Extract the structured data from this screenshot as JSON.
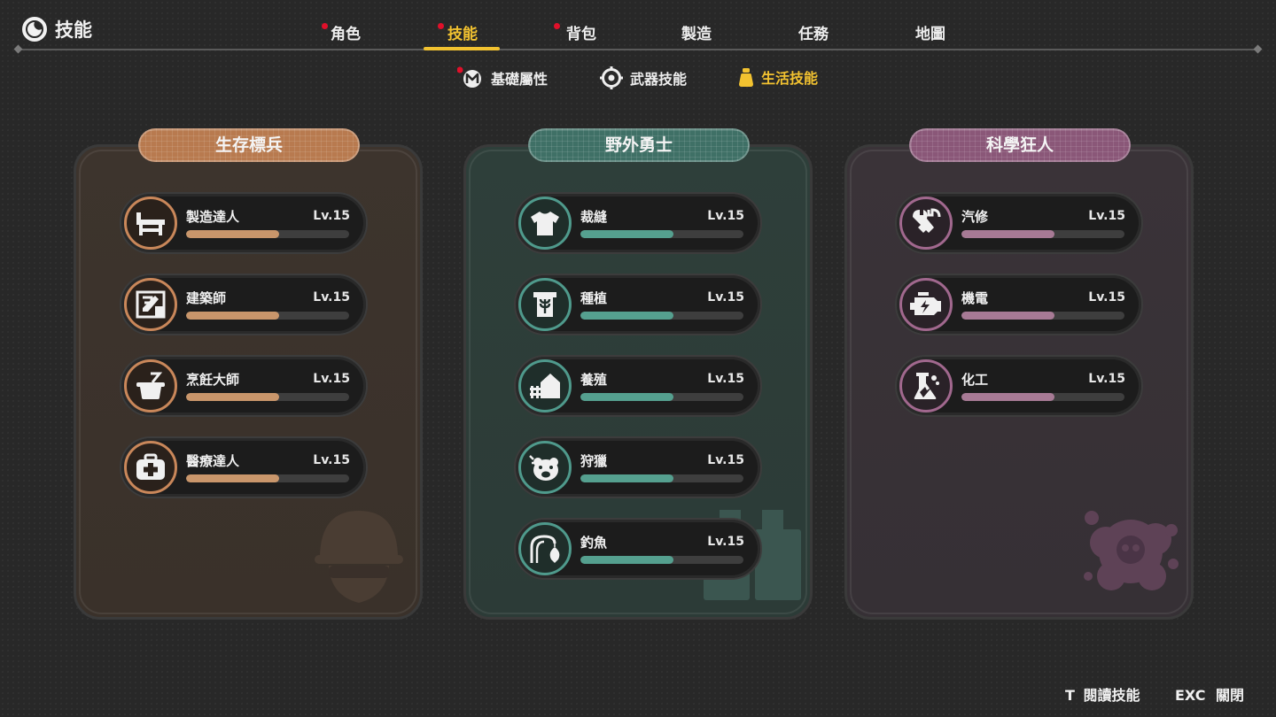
{
  "header": {
    "title": "技能",
    "title_icon": "moon-swirl-icon"
  },
  "tabs": [
    {
      "label": "角色",
      "has_dot": true,
      "active": false
    },
    {
      "label": "技能",
      "has_dot": true,
      "active": true
    },
    {
      "label": "背包",
      "has_dot": true,
      "active": false
    },
    {
      "label": "製造",
      "has_dot": false,
      "active": false
    },
    {
      "label": "任務",
      "has_dot": false,
      "active": false
    },
    {
      "label": "地圖",
      "has_dot": false,
      "active": false
    }
  ],
  "subtabs": [
    {
      "label": "基礎屬性",
      "icon": "m-badge-icon",
      "has_dot": true,
      "active": false
    },
    {
      "label": "武器技能",
      "icon": "crosshair-icon",
      "has_dot": false,
      "active": false
    },
    {
      "label": "生活技能",
      "icon": "pouch-icon",
      "has_dot": false,
      "active": true
    }
  ],
  "colors": {
    "accent": "#f2c230",
    "notification_dot": "#e0102a",
    "survival": "#c9875a",
    "outdoor": "#4f9a8c",
    "science": "#a1688e"
  },
  "panels": [
    {
      "title": "生存標兵",
      "skills": [
        {
          "name": "製造達人",
          "level": "Lv.15",
          "progress": 0.57,
          "icon": "workbench-icon"
        },
        {
          "name": "建築師",
          "level": "Lv.15",
          "progress": 0.57,
          "icon": "blueprint-icon"
        },
        {
          "name": "烹飪大師",
          "level": "Lv.15",
          "progress": 0.57,
          "icon": "cooking-pot-icon"
        },
        {
          "name": "醫療達人",
          "level": "Lv.15",
          "progress": 0.57,
          "icon": "medkit-icon"
        }
      ]
    },
    {
      "title": "野外勇士",
      "skills": [
        {
          "name": "裁縫",
          "level": "Lv.15",
          "progress": 0.57,
          "icon": "shirt-icon"
        },
        {
          "name": "種植",
          "level": "Lv.15",
          "progress": 0.57,
          "icon": "wheat-sack-icon"
        },
        {
          "name": "養殖",
          "level": "Lv.15",
          "progress": 0.57,
          "icon": "barn-icon"
        },
        {
          "name": "狩獵",
          "level": "Lv.15",
          "progress": 0.57,
          "icon": "bear-icon"
        },
        {
          "name": "釣魚",
          "level": "Lv.15",
          "progress": 0.57,
          "icon": "fishing-rod-icon"
        }
      ]
    },
    {
      "title": "科學狂人",
      "skills": [
        {
          "name": "汽修",
          "level": "Lv.15",
          "progress": 0.57,
          "icon": "wrenches-icon"
        },
        {
          "name": "機電",
          "level": "Lv.15",
          "progress": 0.57,
          "icon": "engine-icon"
        },
        {
          "name": "化工",
          "level": "Lv.15",
          "progress": 0.57,
          "icon": "flask-icon"
        }
      ]
    }
  ],
  "footer": {
    "read_key": "T",
    "read_label": "閱讀技能",
    "close_key": "EXC",
    "close_label": "關閉"
  }
}
